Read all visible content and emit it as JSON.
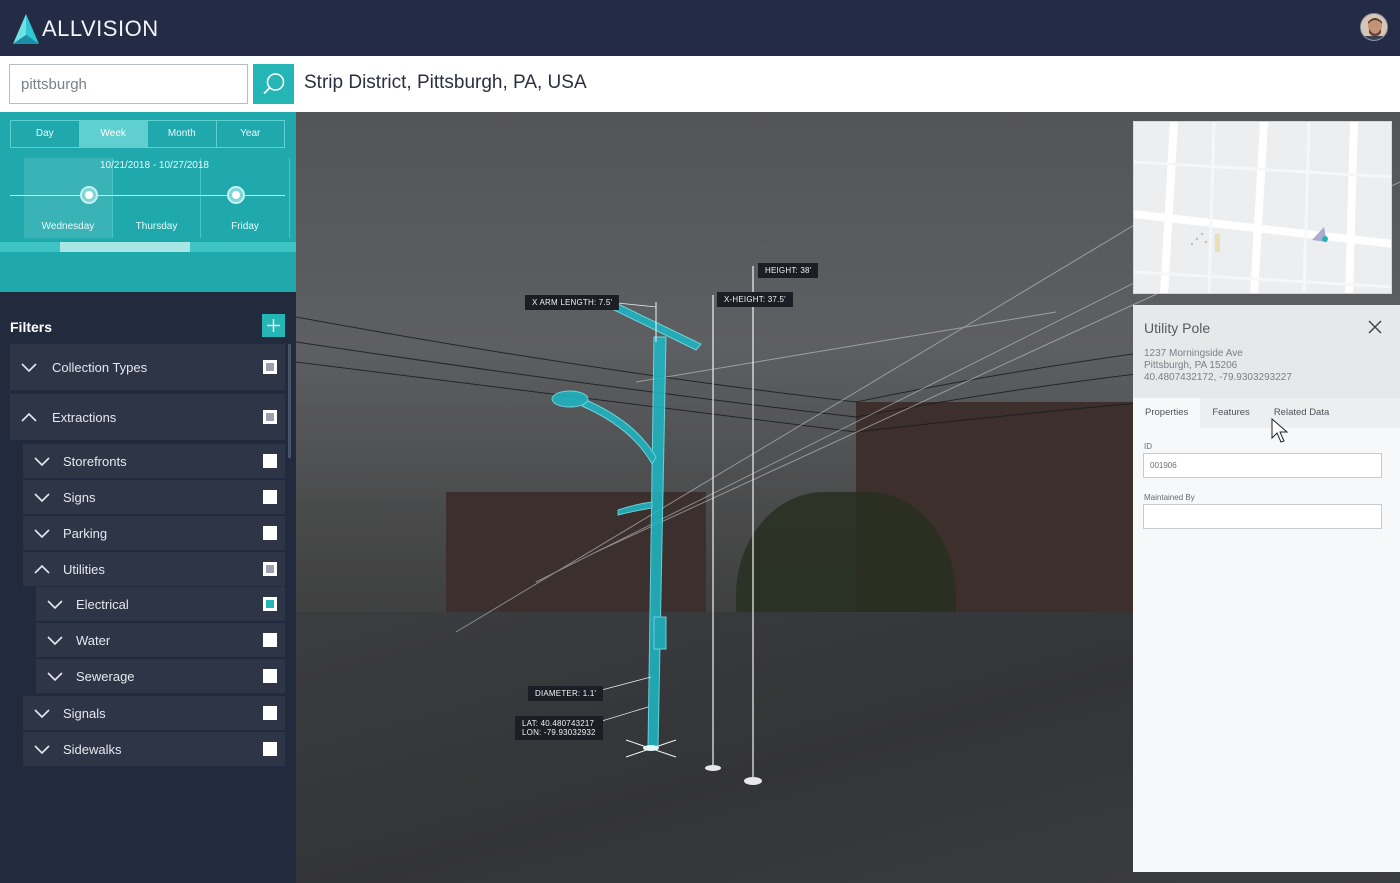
{
  "header": {
    "logo_text": "ALLVISION",
    "brand_color": "#25b5b5"
  },
  "search": {
    "value": "pittsburgh",
    "location": "Strip District, Pittsburgh, PA, USA"
  },
  "timeline": {
    "tabs": [
      "Day",
      "Week",
      "Month",
      "Year"
    ],
    "active_tab": "Week",
    "date_range": "10/21/2018 - 10/27/2018",
    "days": [
      "Wednesday",
      "Thursday",
      "Friday"
    ]
  },
  "filters": {
    "title": "Filters",
    "items": [
      {
        "label": "Collection Types",
        "state": "partial",
        "expanded": false
      },
      {
        "label": "Extractions",
        "state": "partial",
        "expanded": true
      },
      {
        "label": "Storefronts",
        "state": "unchecked",
        "expanded": false
      },
      {
        "label": "Signs",
        "state": "unchecked",
        "expanded": false
      },
      {
        "label": "Parking",
        "state": "unchecked",
        "expanded": false
      },
      {
        "label": "Utilities",
        "state": "partial",
        "expanded": true
      },
      {
        "label": "Electrical",
        "state": "checked",
        "expanded": false
      },
      {
        "label": "Water",
        "state": "unchecked",
        "expanded": false
      },
      {
        "label": "Sewerage",
        "state": "unchecked",
        "expanded": false
      },
      {
        "label": "Signals",
        "state": "unchecked",
        "expanded": false
      },
      {
        "label": "Sidewalks",
        "state": "unchecked",
        "expanded": false
      }
    ]
  },
  "measurements": {
    "height": "HEIGHT: 38'",
    "x_arm_length": "X ARM LENGTH: 7.5'",
    "x_height": "X-HEIGHT: 37.5'",
    "diameter": "DIAMETER: 1.1'",
    "lat": "LAT:  40.480743217",
    "lon": "LON:  -79.93032932"
  },
  "detail": {
    "title": "Utility Pole",
    "address_line1": "1237 Morningside Ave",
    "address_line2": "Pittsburgh, PA 15206",
    "coords": "40.4807432172, -79.9303293227",
    "tabs": [
      "Properties",
      "Features",
      "Related Data"
    ],
    "active_tab": "Properties",
    "fields": [
      {
        "label": "ID",
        "value": "001906"
      },
      {
        "label": "Maintained By",
        "value": ""
      }
    ]
  }
}
